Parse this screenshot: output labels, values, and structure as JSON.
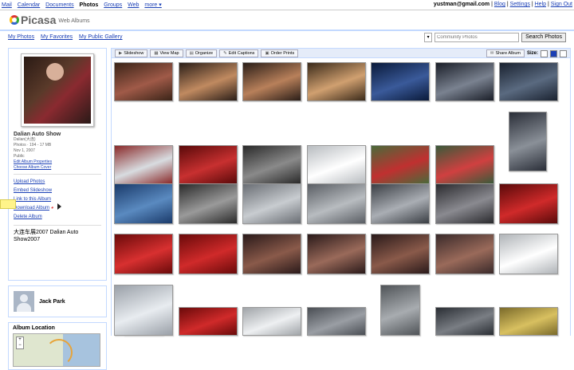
{
  "top_nav": {
    "items": [
      "Mail",
      "Calendar",
      "Documents",
      "Photos",
      "Groups",
      "Web",
      "more ▾"
    ],
    "current": "Photos"
  },
  "top_right": {
    "email": "yustman@gmail.com",
    "links": [
      "Blog",
      "Settings",
      "Help",
      "Sign Out"
    ]
  },
  "logo": {
    "name": "Picasa",
    "tagline": "Web Albums"
  },
  "sub_links": [
    "My Photos",
    "My Favorites",
    "My Public Gallery"
  ],
  "search": {
    "placeholder": "Community Photos",
    "button": "Search Photos"
  },
  "album": {
    "title": "Dalian Auto Show",
    "location": "Dalian(大连)",
    "photos": "Photos · 194 - 17 MB",
    "date": "Nov 1, 2007",
    "visibility": "Public",
    "edit_link": "Edit Album Properties",
    "cover_link": "Choose Album Cover",
    "actions": [
      "Upload Photos",
      "Embed Slideshow",
      "Link to this Album",
      "Download Album",
      "Delete Album"
    ],
    "description": "大连车展2007 Dalian Auto Show2007"
  },
  "user": {
    "name": "Jack Park"
  },
  "location_box": {
    "title": "Album Location",
    "zoom_plus": "+",
    "zoom_minus": "−"
  },
  "toolbar": {
    "buttons": [
      "Slideshow",
      "View Map",
      "Organize",
      "Edit Captions",
      "Order Prints"
    ],
    "share": "Share Album",
    "size_label": "Size:"
  },
  "colors": {
    "link": "#1a3fb5",
    "border": "#c3d9ff",
    "toolbar_bg": "#e5ecf9"
  },
  "photos": [
    {
      "subject": "model on stage",
      "colors": [
        "#3a2418",
        "#a05a48"
      ]
    },
    {
      "subject": "models at car show",
      "colors": [
        "#2a1e18",
        "#c08a60"
      ]
    },
    {
      "subject": "models at car show",
      "colors": [
        "#2a1e18",
        "#b8805a"
      ]
    },
    {
      "subject": "models at car show",
      "colors": [
        "#3a2a1a",
        "#d0a070"
      ]
    },
    {
      "subject": "blue car",
      "colors": [
        "#0a1a3a",
        "#3a5a9a"
      ]
    },
    {
      "subject": "toyota grille",
      "colors": [
        "#1a1e28",
        "#7a8290"
      ]
    },
    {
      "subject": "blue car front",
      "colors": [
        "#1a2230",
        "#5a6a80"
      ]
    },
    {
      "subject": "tent exhibit",
      "colors": [
        "#8a2a2a",
        "#d8dce0"
      ]
    },
    {
      "subject": "red suv",
      "colors": [
        "#5a0a0a",
        "#c83030"
      ]
    },
    {
      "subject": "suv interior",
      "colors": [
        "#2a2a2a",
        "#8a8a8a"
      ]
    },
    {
      "subject": "white honda",
      "colors": [
        "#b8bcc0",
        "#ffffff"
      ]
    },
    {
      "subject": "umbrellas crowd",
      "colors": [
        "#4a6a3a",
        "#c03030"
      ]
    },
    {
      "subject": "umbrellas crowd",
      "colors": [
        "#3a5a3a",
        "#d04040"
      ]
    },
    {
      "subject": "honda crv",
      "colors": [
        "#2a2e38",
        "#8a9098"
      ]
    },
    {
      "subject": "blue hatchback",
      "colors": [
        "#1a3a6a",
        "#5a8ac0"
      ]
    },
    {
      "subject": "audi grille",
      "colors": [
        "#2a2a2a",
        "#9a9a9a"
      ]
    },
    {
      "subject": "silver car",
      "colors": [
        "#6a6e74",
        "#c8ccd0"
      ]
    },
    {
      "subject": "silver car",
      "colors": [
        "#5a5e64",
        "#b8bcc0"
      ]
    },
    {
      "subject": "lexus is300",
      "colors": [
        "#3a3e44",
        "#aaaeb4"
      ]
    },
    {
      "subject": "lexus grille",
      "colors": [
        "#2a2a2e",
        "#8a8a90"
      ]
    },
    {
      "subject": "red car",
      "colors": [
        "#5a0a0a",
        "#d02a2a"
      ]
    },
    {
      "subject": "red car",
      "colors": [
        "#6a0a0a",
        "#d83030"
      ]
    },
    {
      "subject": "red car",
      "colors": [
        "#6a0a0a",
        "#d02a2a"
      ]
    },
    {
      "subject": "dancers",
      "colors": [
        "#2a1a1a",
        "#8a5a4a"
      ]
    },
    {
      "subject": "dancers",
      "colors": [
        "#2a1a1a",
        "#9a6a5a"
      ]
    },
    {
      "subject": "dancers",
      "colors": [
        "#2a1a1a",
        "#8a5a4a"
      ]
    },
    {
      "subject": "dancers",
      "colors": [
        "#3a2a2a",
        "#9a6a5a"
      ]
    },
    {
      "subject": "white sports car",
      "colors": [
        "#b0b4b8",
        "#ffffff"
      ]
    },
    {
      "subject": "blue car",
      "colors": [
        "#1a3a6a",
        "#4a7ab0"
      ]
    },
    {
      "subject": "red car",
      "colors": [
        "#6a0a0a",
        "#d02a2a"
      ]
    },
    {
      "subject": "white car",
      "colors": [
        "#a0a4a8",
        "#eef0f2"
      ]
    },
    {
      "subject": "silver car",
      "colors": [
        "#4a4e54",
        "#9a9ea4"
      ]
    },
    {
      "subject": "silver car",
      "colors": [
        "#505458",
        "#a8acb0"
      ]
    },
    {
      "subject": "car front",
      "colors": [
        "#2a2e34",
        "#7a7e84"
      ]
    },
    {
      "subject": "gold car",
      "colors": [
        "#7a6a2a",
        "#d8c060"
      ]
    },
    {
      "subject": "white car",
      "colors": [
        "#9aa0a8",
        "#e8ecf0"
      ]
    }
  ]
}
